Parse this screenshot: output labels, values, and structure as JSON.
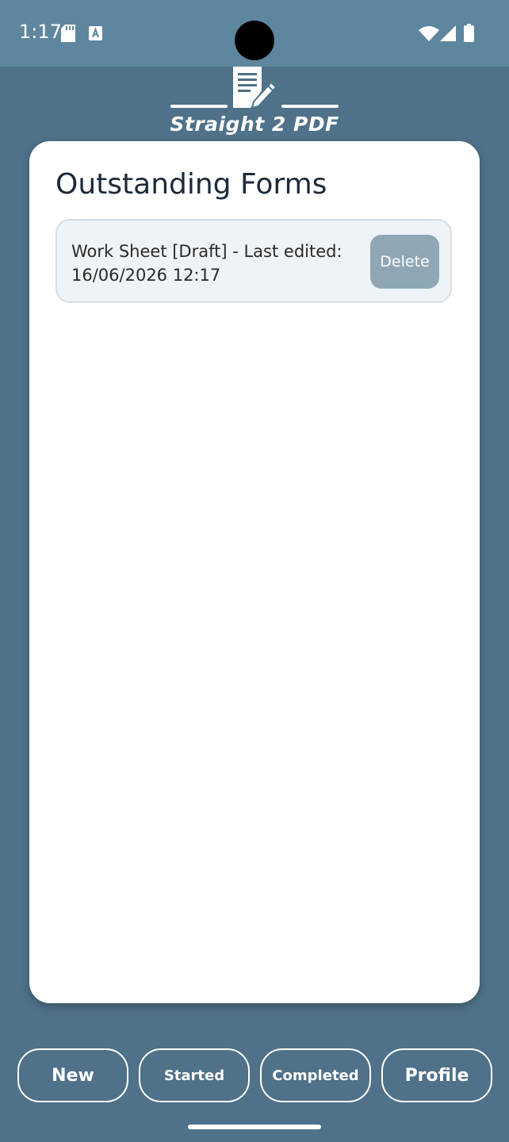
{
  "status_bar": {
    "time": "1:17",
    "left_icons": [
      "sd-card-icon",
      "app-notification-icon"
    ],
    "right_icons": [
      "wifi-icon",
      "cell-signal-icon",
      "battery-icon"
    ]
  },
  "header": {
    "logo_icon": "document-pencil-icon",
    "app_name": "Straight 2 PDF"
  },
  "main": {
    "title": "Outstanding Forms",
    "forms": [
      {
        "text": "Work Sheet [Draft] - Last edited: 16/06/2026 12:17",
        "delete_label": "Delete"
      }
    ]
  },
  "bottom_nav": {
    "items": [
      {
        "label": "New"
      },
      {
        "label": "Started"
      },
      {
        "label": "Completed"
      },
      {
        "label": "Profile"
      }
    ]
  },
  "colors": {
    "background": "#4f7189",
    "status_bar": "#5e879f",
    "card": "#ffffff",
    "item_bg": "#eef3f7",
    "delete_button": "#8fa7b5"
  }
}
